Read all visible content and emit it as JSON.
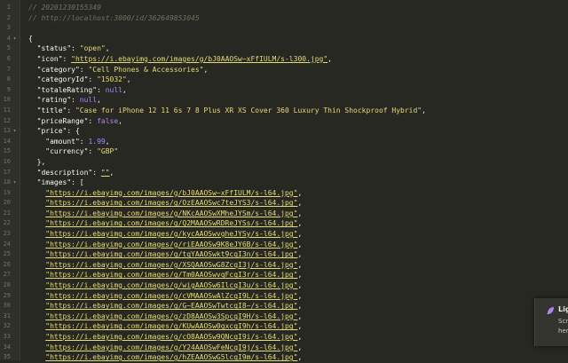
{
  "editor": {
    "lines": [
      {
        "n": "1",
        "fold": "",
        "segs": [
          {
            "t": "cmt",
            "v": "// 20201230155349"
          }
        ]
      },
      {
        "n": "2",
        "fold": "",
        "segs": [
          {
            "t": "cmt",
            "v": "// http://localhost:3000/id/362649853045"
          }
        ]
      },
      {
        "n": "3",
        "fold": "",
        "segs": []
      },
      {
        "n": "4",
        "fold": "▾",
        "segs": [
          {
            "t": "key",
            "v": "{"
          }
        ]
      },
      {
        "n": "5",
        "fold": "",
        "segs": [
          {
            "t": "key",
            "v": "  \"status\": "
          },
          {
            "t": "str",
            "v": "\"open\""
          },
          {
            "t": "key",
            "v": ","
          }
        ]
      },
      {
        "n": "6",
        "fold": "",
        "segs": [
          {
            "t": "key",
            "v": "  \"icon\": "
          },
          {
            "t": "link",
            "v": "\"https://i.ebayimg.com/images/g/bJ0AAOSw~xFfIULM/s-l300.jpg\""
          },
          {
            "t": "key",
            "v": ","
          }
        ]
      },
      {
        "n": "7",
        "fold": "",
        "segs": [
          {
            "t": "key",
            "v": "  \"category\": "
          },
          {
            "t": "str",
            "v": "\"Cell Phones & Accessories\""
          },
          {
            "t": "key",
            "v": ","
          }
        ]
      },
      {
        "n": "8",
        "fold": "",
        "segs": [
          {
            "t": "key",
            "v": "  \"categoryId\": "
          },
          {
            "t": "str",
            "v": "\"15032\""
          },
          {
            "t": "key",
            "v": ","
          }
        ]
      },
      {
        "n": "9",
        "fold": "",
        "segs": [
          {
            "t": "key",
            "v": "  \"totaleRating\": "
          },
          {
            "t": "kw",
            "v": "null"
          },
          {
            "t": "key",
            "v": ","
          }
        ]
      },
      {
        "n": "10",
        "fold": "",
        "segs": [
          {
            "t": "key",
            "v": "  \"rating\": "
          },
          {
            "t": "kw",
            "v": "null"
          },
          {
            "t": "key",
            "v": ","
          }
        ]
      },
      {
        "n": "11",
        "fold": "",
        "segs": [
          {
            "t": "key",
            "v": "  \"title\": "
          },
          {
            "t": "str",
            "v": "\"Case for iPhone 12 11 6s 7 8 Plus XR XS Cover 360 Luxury Thin Shockproof Hybrid\""
          },
          {
            "t": "key",
            "v": ","
          }
        ]
      },
      {
        "n": "12",
        "fold": "",
        "segs": [
          {
            "t": "key",
            "v": "  \"priceRange\": "
          },
          {
            "t": "kw",
            "v": "false"
          },
          {
            "t": "key",
            "v": ","
          }
        ]
      },
      {
        "n": "13",
        "fold": "▾",
        "segs": [
          {
            "t": "key",
            "v": "  \"price\": {"
          }
        ]
      },
      {
        "n": "14",
        "fold": "",
        "segs": [
          {
            "t": "key",
            "v": "    \"amount\": "
          },
          {
            "t": "num",
            "v": "1.99"
          },
          {
            "t": "key",
            "v": ","
          }
        ]
      },
      {
        "n": "15",
        "fold": "",
        "segs": [
          {
            "t": "key",
            "v": "    \"currency\": "
          },
          {
            "t": "str",
            "v": "\"GBP\""
          }
        ]
      },
      {
        "n": "16",
        "fold": "",
        "segs": [
          {
            "t": "key",
            "v": "  },"
          }
        ]
      },
      {
        "n": "17",
        "fold": "",
        "segs": [
          {
            "t": "key",
            "v": "  \"description\": "
          },
          {
            "t": "link",
            "v": "\"\""
          },
          {
            "t": "key",
            "v": ","
          }
        ]
      },
      {
        "n": "18",
        "fold": "▾",
        "segs": [
          {
            "t": "key",
            "v": "  \"images\": ["
          }
        ]
      },
      {
        "n": "19",
        "fold": "",
        "segs": [
          {
            "t": "key",
            "v": "    "
          },
          {
            "t": "link",
            "v": "\"https://i.ebayimg.com/images/g/bJ0AAOSw~xFfIULM/s-l64.jpg\""
          },
          {
            "t": "key",
            "v": ","
          }
        ]
      },
      {
        "n": "20",
        "fold": "",
        "segs": [
          {
            "t": "key",
            "v": "    "
          },
          {
            "t": "link",
            "v": "\"https://i.ebayimg.com/images/g/OzEAAOSwc7teJYS3/s-l64.jpg\""
          },
          {
            "t": "key",
            "v": ","
          }
        ]
      },
      {
        "n": "21",
        "fold": "",
        "segs": [
          {
            "t": "key",
            "v": "    "
          },
          {
            "t": "link",
            "v": "\"https://i.ebayimg.com/images/g/NKcAAOSwXMheJYSm/s-l64.jpg\""
          },
          {
            "t": "key",
            "v": ","
          }
        ]
      },
      {
        "n": "22",
        "fold": "",
        "segs": [
          {
            "t": "key",
            "v": "    "
          },
          {
            "t": "link",
            "v": "\"https://i.ebayimg.com/images/g/Q2MAAOSwRDReJYSs/s-l64.jpg\""
          },
          {
            "t": "key",
            "v": ","
          }
        ]
      },
      {
        "n": "23",
        "fold": "",
        "segs": [
          {
            "t": "key",
            "v": "    "
          },
          {
            "t": "link",
            "v": "\"https://i.ebayimg.com/images/g/kycAAOSwvgheJYSy/s-l64.jpg\""
          },
          {
            "t": "key",
            "v": ","
          }
        ]
      },
      {
        "n": "24",
        "fold": "",
        "segs": [
          {
            "t": "key",
            "v": "    "
          },
          {
            "t": "link",
            "v": "\"https://i.ebayimg.com/images/g/riEAAOSw9K8eJY6B/s-l64.jpg\""
          },
          {
            "t": "key",
            "v": ","
          }
        ]
      },
      {
        "n": "25",
        "fold": "",
        "segs": [
          {
            "t": "key",
            "v": "    "
          },
          {
            "t": "link",
            "v": "\"https://i.ebayimg.com/images/g/tqYAAOSwkt9cqI3n/s-l64.jpg\""
          },
          {
            "t": "key",
            "v": ","
          }
        ]
      },
      {
        "n": "26",
        "fold": "",
        "segs": [
          {
            "t": "key",
            "v": "    "
          },
          {
            "t": "link",
            "v": "\"https://i.ebayimg.com/images/g/XSQAAOSwG8ZcqI3j/s-l64.jpg\""
          },
          {
            "t": "key",
            "v": ","
          }
        ]
      },
      {
        "n": "27",
        "fold": "",
        "segs": [
          {
            "t": "key",
            "v": "    "
          },
          {
            "t": "link",
            "v": "\"https://i.ebayimg.com/images/g/Tm0AAOSwvqFcqI3r/s-l64.jpg\""
          },
          {
            "t": "key",
            "v": ","
          }
        ]
      },
      {
        "n": "28",
        "fold": "",
        "segs": [
          {
            "t": "key",
            "v": "    "
          },
          {
            "t": "link",
            "v": "\"https://i.ebayimg.com/images/g/wigAAOSw6IlcqI3u/s-l64.jpg\""
          },
          {
            "t": "key",
            "v": ","
          }
        ]
      },
      {
        "n": "29",
        "fold": "",
        "segs": [
          {
            "t": "key",
            "v": "    "
          },
          {
            "t": "link",
            "v": "\"https://i.ebayimg.com/images/g/cVMAAOSwAlZcqI9L/s-l64.jpg\""
          },
          {
            "t": "key",
            "v": ","
          }
        ]
      },
      {
        "n": "30",
        "fold": "",
        "segs": [
          {
            "t": "key",
            "v": "    "
          },
          {
            "t": "link",
            "v": "\"https://i.ebayimg.com/images/g/G~EAAOSwTwtcqI8~/s-l64.jpg\""
          },
          {
            "t": "key",
            "v": ","
          }
        ]
      },
      {
        "n": "31",
        "fold": "",
        "segs": [
          {
            "t": "key",
            "v": "    "
          },
          {
            "t": "link",
            "v": "\"https://i.ebayimg.com/images/g/zD8AAOSw3SpcqI9H/s-l64.jpg\""
          },
          {
            "t": "key",
            "v": ","
          }
        ]
      },
      {
        "n": "32",
        "fold": "",
        "segs": [
          {
            "t": "key",
            "v": "    "
          },
          {
            "t": "link",
            "v": "\"https://i.ebayimg.com/images/g/KUwAAOSw0gxcqI9h/s-l64.jpg\""
          },
          {
            "t": "key",
            "v": ","
          }
        ]
      },
      {
        "n": "33",
        "fold": "",
        "segs": [
          {
            "t": "key",
            "v": "    "
          },
          {
            "t": "link",
            "v": "\"https://i.ebayimg.com/images/g/cO8AAOSw9QNcqI9i/s-l64.jpg\""
          },
          {
            "t": "key",
            "v": ","
          }
        ]
      },
      {
        "n": "34",
        "fold": "",
        "segs": [
          {
            "t": "key",
            "v": "    "
          },
          {
            "t": "link",
            "v": "\"https://i.ebayimg.com/images/g/Y24AAOSwFeNcqI9j/s-l64.jpg\""
          },
          {
            "t": "key",
            "v": ","
          }
        ]
      },
      {
        "n": "35",
        "fold": "",
        "segs": [
          {
            "t": "key",
            "v": "    "
          },
          {
            "t": "link",
            "v": "\"https://i.ebayimg.com/images/g/hZEAAOSwG5lcqI9m/s-l64.jpg\""
          },
          {
            "t": "key",
            "v": ","
          }
        ]
      }
    ]
  },
  "toast": {
    "title": "Lig",
    "line1": "Scr",
    "line2": "here",
    "icon": "feather-icon",
    "accent": "#b583f5"
  }
}
